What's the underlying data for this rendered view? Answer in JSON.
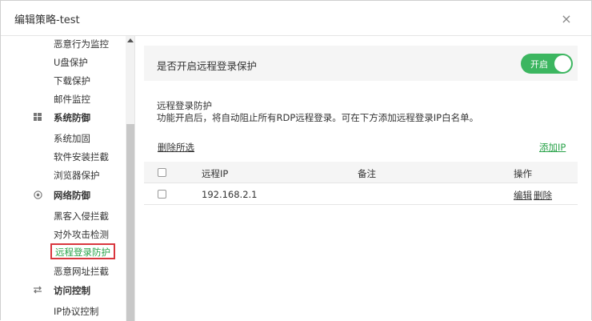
{
  "dialog": {
    "title": "编辑策略-test",
    "close_glyph": "×"
  },
  "sidebar": {
    "items": [
      {
        "label": "恶意行为监控"
      },
      {
        "label": "U盘保护"
      },
      {
        "label": "下载保护"
      },
      {
        "label": "邮件监控"
      }
    ],
    "groups": [
      {
        "label": "系统防御",
        "icon": "windows-icon"
      },
      {
        "label": "网络防御",
        "icon": "globe-icon"
      },
      {
        "label": "访问控制",
        "icon": "transfer-icon"
      }
    ],
    "system_items": [
      {
        "label": "系统加固"
      },
      {
        "label": "软件安装拦截"
      },
      {
        "label": "浏览器保护"
      }
    ],
    "network_items": [
      {
        "label": "黑客入侵拦截"
      },
      {
        "label": "对外攻击检测"
      },
      {
        "label": "远程登录防护",
        "active": true
      },
      {
        "label": "恶意网址拦截"
      }
    ],
    "access_items": [
      {
        "label": "IP协议控制"
      }
    ]
  },
  "main": {
    "toggle_label": "是否开启远程登录保护",
    "toggle_state": "开启",
    "accent_color": "#3cb660",
    "section_title": "远程登录防护",
    "section_desc": "功能开启后，将自动阻止所有RDP远程登录。可在下方添加远程登录IP白名单。",
    "delete_selected": "删除所选",
    "add_ip": "添加IP"
  },
  "table": {
    "headers": [
      "远程IP",
      "备注",
      "操作"
    ],
    "rows": [
      {
        "ip": "192.168.2.1",
        "note": "",
        "edit": "编辑",
        "delete": "删除"
      }
    ]
  }
}
